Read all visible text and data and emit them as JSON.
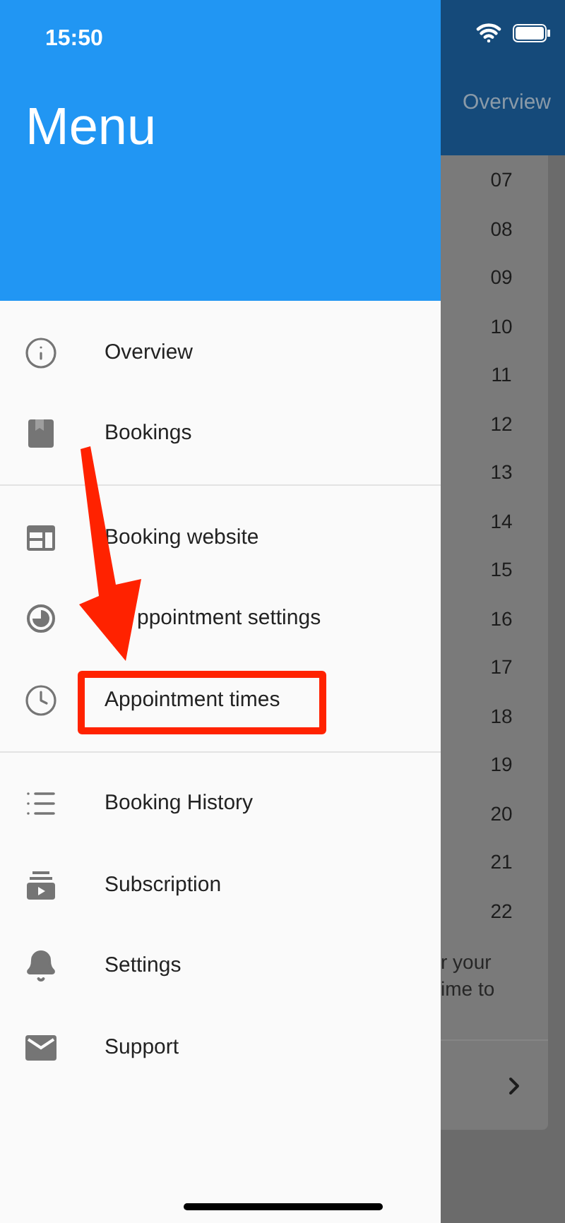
{
  "status_bar": {
    "time": "15:50"
  },
  "drawer": {
    "title": "Menu",
    "sections": [
      {
        "items": [
          "Overview",
          "Bookings"
        ]
      },
      {
        "items": [
          "Booking website",
          "ppointment settings",
          "Appointment times"
        ]
      },
      {
        "items": [
          "Booking History",
          "Subscription",
          "Settings",
          "Support"
        ]
      }
    ]
  },
  "background": {
    "app_bar_title": "Overview",
    "hours": [
      "07",
      "08",
      "09",
      "10",
      "11",
      "12",
      "13",
      "14",
      "15",
      "16",
      "17",
      "18",
      "19",
      "20",
      "21",
      "22"
    ],
    "note_lines": [
      "r your",
      "ime to"
    ]
  }
}
